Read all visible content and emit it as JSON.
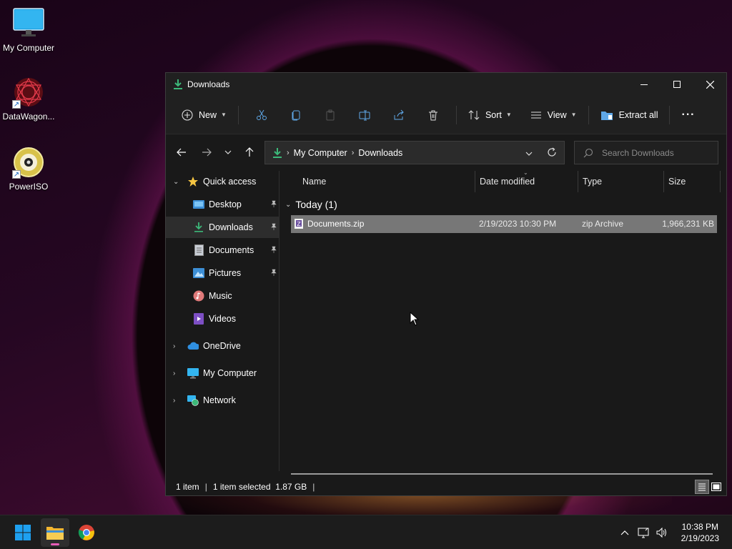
{
  "desktop": {
    "icons": [
      {
        "label": "My Computer"
      },
      {
        "label": "DataWagon..."
      },
      {
        "label": "PowerISO"
      }
    ]
  },
  "window": {
    "title": "Downloads",
    "toolbar": {
      "new_label": "New",
      "sort_label": "Sort",
      "view_label": "View",
      "extract_label": "Extract all",
      "more_label": "···"
    },
    "address": {
      "crumbs": [
        "My Computer",
        "Downloads"
      ],
      "separator": "›"
    },
    "search": {
      "placeholder": "Search Downloads"
    },
    "sidebar": {
      "quick_access": "Quick access",
      "items": [
        {
          "label": "Desktop",
          "pinned": true
        },
        {
          "label": "Downloads",
          "pinned": true,
          "selected": true
        },
        {
          "label": "Documents",
          "pinned": true
        },
        {
          "label": "Pictures",
          "pinned": true
        },
        {
          "label": "Music"
        },
        {
          "label": "Videos"
        }
      ],
      "onedrive": "OneDrive",
      "my_computer": "My Computer",
      "network": "Network"
    },
    "columns": {
      "name": "Name",
      "date_modified": "Date modified",
      "type": "Type",
      "size": "Size"
    },
    "groups": [
      {
        "header": "Today (1)",
        "files": [
          {
            "name": "Documents.zip",
            "date_modified": "2/19/2023 10:30 PM",
            "type": "zip Archive",
            "size": "1,966,231 KB",
            "selected": true
          }
        ]
      }
    ],
    "status": {
      "item_count": "1 item",
      "selection": "1 item selected  1.87 GB",
      "separator": "|"
    }
  },
  "taskbar": {
    "clock_time": "10:38 PM",
    "clock_date": "2/19/2023"
  },
  "colors": {
    "selection_row": "#777777",
    "window_bg": "#191919",
    "taskbar_bg": "#1c1c1c",
    "accent_green": "#3cb879"
  }
}
